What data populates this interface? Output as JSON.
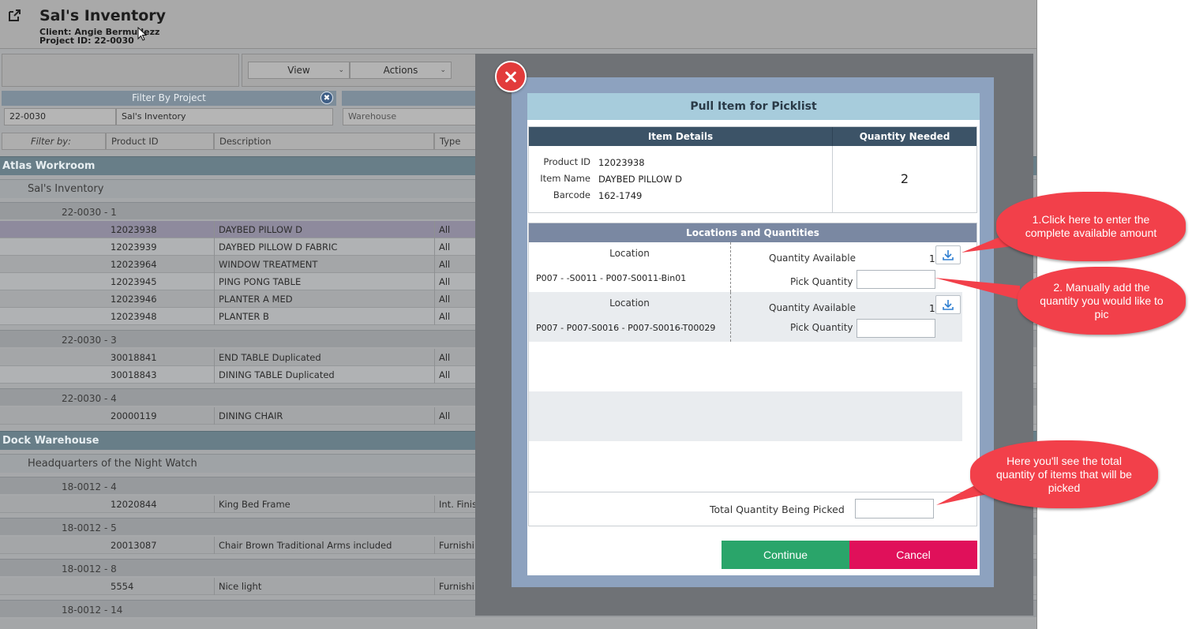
{
  "header": {
    "title": "Sal's Inventory",
    "client": "Client: Angie Bermudezz",
    "project_id": "Project ID: 22-0030"
  },
  "toolbar": {
    "view_label": "View",
    "actions_label": "Actions"
  },
  "filter": {
    "heading": "Filter By Project",
    "project_code": "22-0030",
    "project_name": "Sal's Inventory",
    "warehouse_placeholder": "Warehouse"
  },
  "columns": {
    "filter_by": "Filter by:",
    "product_id": "Product ID",
    "description": "Description",
    "type": "Type"
  },
  "inventory": {
    "warehouse1": "Atlas Workroom",
    "project1": "Sal's Inventory",
    "g1": "22-0030 - 1",
    "g2": "22-0030 - 3",
    "g3": "22-0030 - 4",
    "warehouse2": "Dock Warehouse",
    "project2": "Headquarters of the Night Watch",
    "g4": "18-0012 - 4",
    "g5": "18-0012 - 5",
    "g6": "18-0012 - 8",
    "g7": "18-0012 - 14",
    "rows": [
      {
        "id": "12023938",
        "desc": "DAYBED PILLOW D",
        "type": "All"
      },
      {
        "id": "12023939",
        "desc": "DAYBED PILLOW D FABRIC",
        "type": "All"
      },
      {
        "id": "12023964",
        "desc": "WINDOW TREATMENT",
        "type": "All"
      },
      {
        "id": "12023945",
        "desc": "PING PONG TABLE",
        "type": "All"
      },
      {
        "id": "12023946",
        "desc": "PLANTER A MED",
        "type": "All"
      },
      {
        "id": "12023948",
        "desc": "PLANTER B",
        "type": "All"
      },
      {
        "id": "30018841",
        "desc": "END TABLE  Duplicated",
        "type": "All"
      },
      {
        "id": "30018843",
        "desc": "DINING TABLE  Duplicated",
        "type": "All"
      },
      {
        "id": "20000119",
        "desc": "DINING CHAIR",
        "type": "All"
      },
      {
        "id": "12020844",
        "desc": "King Bed Frame",
        "type": "Int. Finis"
      },
      {
        "id": "20013087",
        "desc": "Chair Brown Traditional  Arms included",
        "type": "Furnishi"
      },
      {
        "id": "5554",
        "desc": "Nice light",
        "type": "Furnishi"
      }
    ]
  },
  "modal": {
    "title": "Pull Item for Picklist",
    "item_details_heading": "Item Details",
    "quantity_needed_heading": "Quantity Needed",
    "product_id_label": "Product ID",
    "product_id": "12023938",
    "item_name_label": "Item Name",
    "item_name": "DAYBED PILLOW D",
    "barcode_label": "Barcode",
    "barcode": "162-1749",
    "quantity_needed": "2",
    "locations_heading": "Locations and Quantities",
    "locations": [
      {
        "location_label": "Location",
        "location": "P007 - -S0011 - P007-S0011-Bin01",
        "qty_available_label": "Quantity Available",
        "qty_available": "1",
        "pick_quantity_label": "Pick Quantity",
        "pick_quantity": ""
      },
      {
        "location_label": "Location",
        "location": "P007 - P007-S0016 - P007-S0016-T00029",
        "qty_available_label": "Quantity Available",
        "qty_available": "1",
        "pick_quantity_label": "Pick Quantity",
        "pick_quantity": ""
      }
    ],
    "total_label": "Total Quantity Being Picked",
    "total_value": "",
    "continue_label": "Continue",
    "cancel_label": "Cancel"
  },
  "callouts": {
    "c1": "1.Click here to enter the complete  available amount",
    "c2": "2. Manually add the quantity you would like to pic",
    "c3": "Here you'll see the total quantity of items that will be picked"
  },
  "colors": {
    "callout": "#f2404a",
    "continue": "#2aa56a",
    "cancel": "#e0105a",
    "modal_title_bg": "#a7ccdc",
    "section_header": "#3c5367"
  }
}
